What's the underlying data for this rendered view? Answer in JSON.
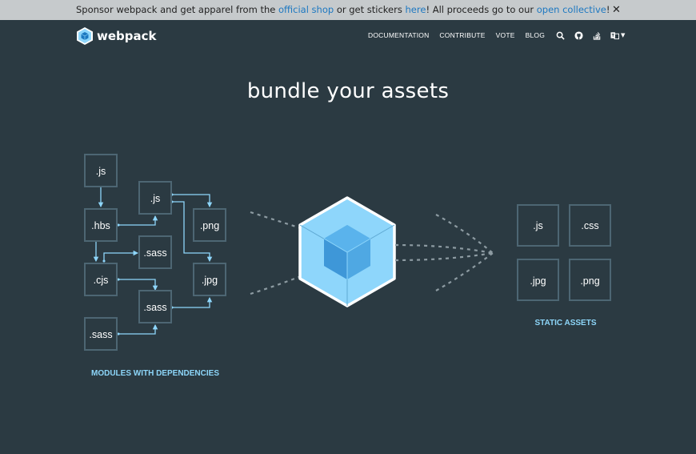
{
  "banner": {
    "text_before": "Sponsor webpack and get apparel from the ",
    "link1": "official shop",
    "text_mid": " or get stickers ",
    "link2": "here",
    "text_mid2": "! All proceeds go to our ",
    "link3": "open collective",
    "text_end": "!",
    "close_symbol": "✕"
  },
  "header": {
    "logo_text": "webpack",
    "nav": [
      "Documentation",
      "Contribute",
      "Vote",
      "Blog"
    ],
    "icons": [
      "search-icon",
      "github-icon",
      "stack-overflow-icon",
      "language-icon"
    ]
  },
  "hero": {
    "title": "bundle your assets"
  },
  "diagram": {
    "modules_caption": "MODULES WITH DEPENDENCIES",
    "assets_caption": "STATIC ASSETS",
    "modules": [
      ".js",
      ".js",
      ".hbs",
      ".png",
      ".sass",
      ".cjs",
      ".jpg",
      ".sass",
      ".sass"
    ],
    "assets": [
      ".js",
      ".css",
      ".jpg",
      ".png"
    ]
  },
  "colors": {
    "background": "#2b3a42",
    "banner": "#c6cacc",
    "accent": "#8dd6f9",
    "box_border": "#4d6673",
    "cube_light": "#8ed6fb",
    "cube_dark": "#1c78c0"
  }
}
